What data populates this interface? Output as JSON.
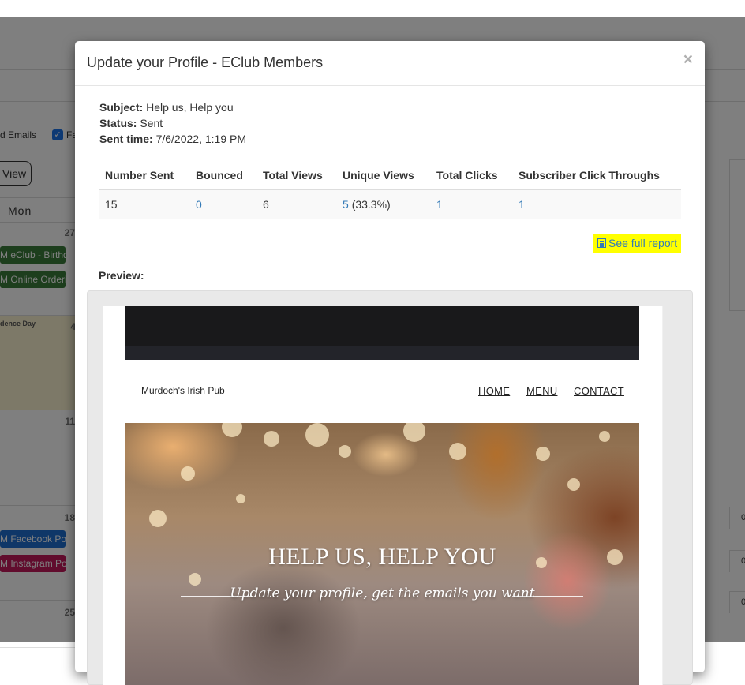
{
  "background": {
    "filter_labels": [
      "d Emails",
      "Fa"
    ],
    "view_button": "View",
    "calendar_header": "Mon",
    "day_numbers": [
      "27",
      "4",
      "11",
      "18",
      "25"
    ],
    "holiday_label": "dence Day",
    "events": [
      {
        "label": "M eClub - Birthd",
        "color": "#3a7d3a"
      },
      {
        "label": "M Online Orderi",
        "color": "#3a7d3a"
      },
      {
        "label": "M Facebook Pos",
        "color": "#1f6fd1"
      },
      {
        "label": "M Instagram Pos",
        "color": "#c2185b"
      }
    ],
    "right_cells": [
      "0",
      "0",
      "0"
    ]
  },
  "modal": {
    "title": "Update your Profile - EClub Members",
    "close": "×",
    "subject_label": "Subject:",
    "subject": "Help us, Help you",
    "status_label": "Status:",
    "status": "Sent",
    "sent_time_label": "Sent time:",
    "sent_time": "7/6/2022, 1:19 PM",
    "stats": {
      "headers": [
        "Number Sent",
        "Bounced",
        "Total Views",
        "Unique Views",
        "Total Clicks",
        "Subscriber Click Throughs"
      ],
      "number_sent": "15",
      "bounced": "0",
      "total_views": "6",
      "unique_views": "5",
      "unique_views_pct": "(33.3%)",
      "total_clicks": "1",
      "subscriber_click_throughs": "1"
    },
    "full_report": "See full report",
    "preview_label": "Preview:"
  },
  "email": {
    "logo": "Murdoch's Irish Pub",
    "nav": [
      "HOME",
      "MENU",
      "CONTACT"
    ],
    "hero_title": "HELP US, HELP YOU",
    "hero_subtitle": "Update your profile, get the emails you want"
  }
}
